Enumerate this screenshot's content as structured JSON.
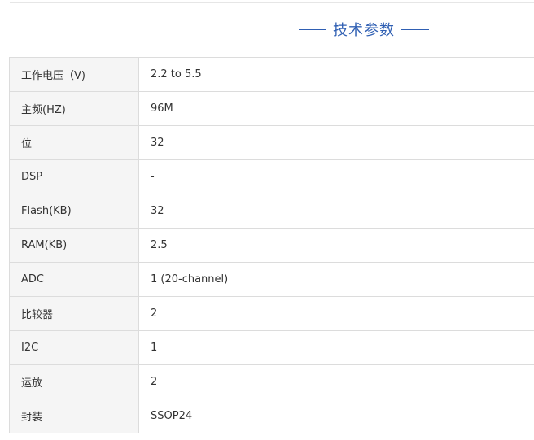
{
  "section_title": "技术参数",
  "specs": [
    {
      "label": "工作电压（V)",
      "value": "2.2 to 5.5"
    },
    {
      "label": "主频(HZ)",
      "value": "96M"
    },
    {
      "label": "位",
      "value": "32"
    },
    {
      "label": "DSP",
      "value": "-"
    },
    {
      "label": "Flash(KB)",
      "value": "32"
    },
    {
      "label": "RAM(KB)",
      "value": "2.5"
    },
    {
      "label": "ADC",
      "value": "1 (20-channel)"
    },
    {
      "label": "比较器",
      "value": "2"
    },
    {
      "label": "I2C",
      "value": "1"
    },
    {
      "label": "运放",
      "value": "2"
    },
    {
      "label": "封装",
      "value": "SSOP24"
    }
  ],
  "colors": {
    "accent": "#2f5fb3",
    "label_bg": "#f5f5f5",
    "border": "#dcdcdc",
    "text": "#333333"
  }
}
